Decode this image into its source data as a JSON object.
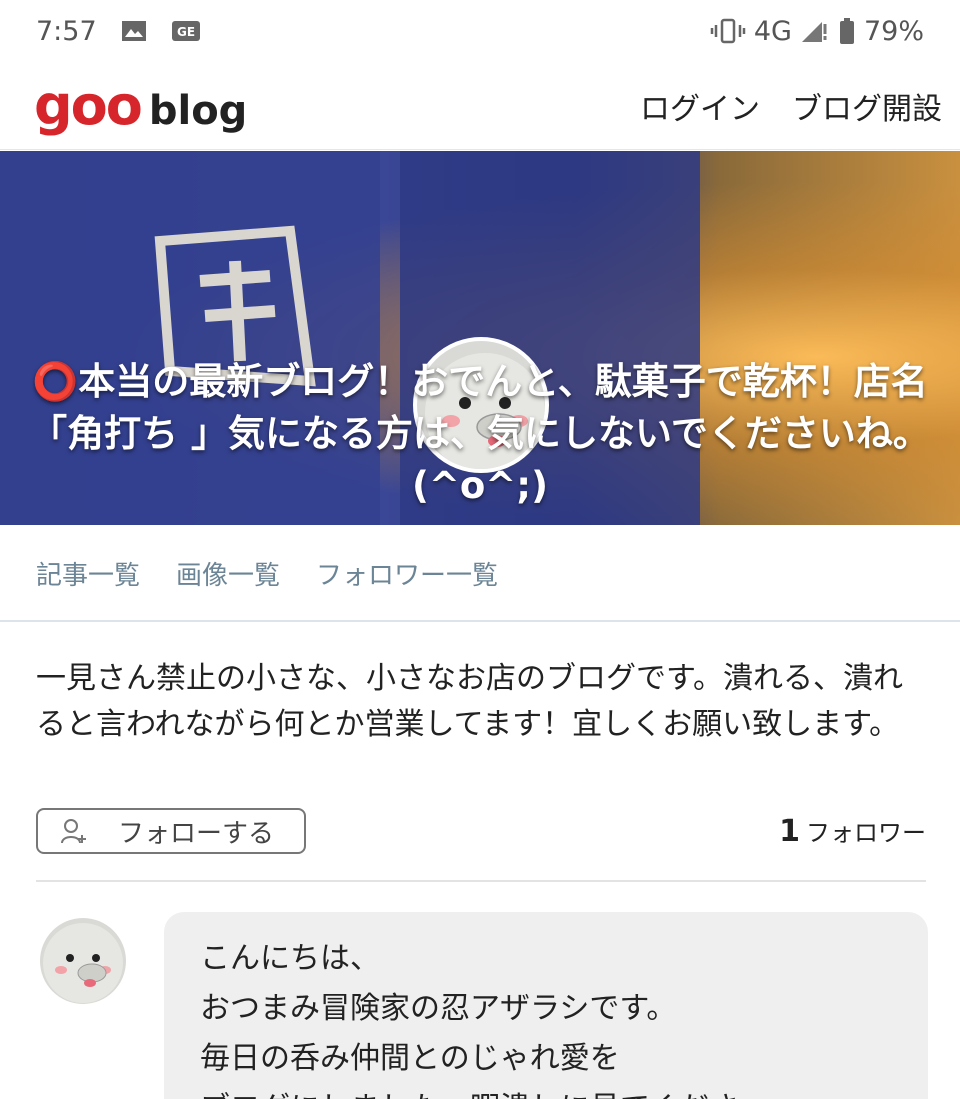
{
  "status_bar": {
    "time": "7:57",
    "network": "4G",
    "battery": "79%",
    "icons": [
      "image-icon",
      "ge-icon",
      "vibrate-icon",
      "signal-icon",
      "battery-icon"
    ]
  },
  "header": {
    "logo_goo": "goo",
    "logo_blog": "blog",
    "login": "ログイン",
    "open_blog": "ブログ開設"
  },
  "hero": {
    "title": "⭕本当の最新ブログ！おでんと、駄菓子で乾杯！店名「角打ち 」気になる方は、気にしないでくださいね。(^o^;)"
  },
  "tabs": [
    {
      "label": "記事一覧"
    },
    {
      "label": "画像一覧"
    },
    {
      "label": "フォロワー一覧"
    }
  ],
  "description": "一見さん禁止の小さな、小さなお店のブログです。潰れる、潰れると言われながら何とか営業してます！宜しくお願い致します。",
  "follow": {
    "button_label": "フォローする",
    "count": "1",
    "count_label": "フォロワー"
  },
  "message": {
    "lines": [
      "こんにちは、",
      "おつまみ冒険家の忍アザラシです。",
      "毎日の呑み仲間とのじゃれ愛を",
      "ブログにしました。暇潰しに見てくださ"
    ]
  },
  "colors": {
    "brand_red": "#d7262b",
    "tab_text": "#6c8596",
    "bubble_bg": "#efefef"
  }
}
